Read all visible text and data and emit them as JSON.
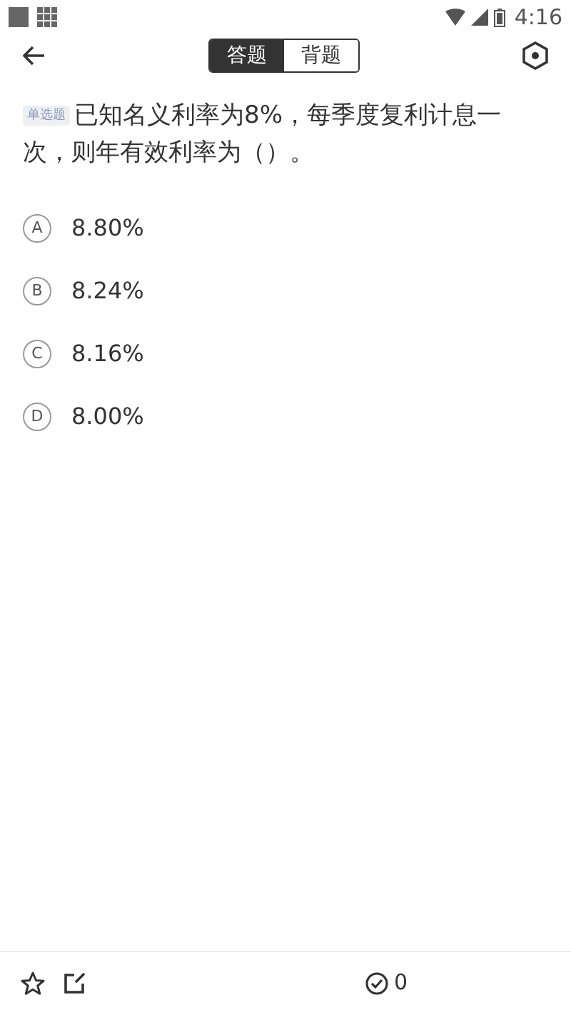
{
  "status_bar": {
    "time": "4:16"
  },
  "header": {
    "tabs": [
      {
        "label": "答题",
        "selected": true
      },
      {
        "label": "背题",
        "selected": false
      }
    ]
  },
  "question": {
    "type_tag": "单选题",
    "text": "已知名义利率为8%，每季度复利计息一次，则年有效利率为（）。"
  },
  "options": [
    {
      "letter": "A",
      "text": "8.80%",
      "selected": false
    },
    {
      "letter": "B",
      "text": "8.24%",
      "selected": false
    },
    {
      "letter": "C",
      "text": "8.16%",
      "selected": false
    },
    {
      "letter": "D",
      "text": "8.00%",
      "selected": false
    }
  ],
  "bottom_bar": {
    "correct_count": "0"
  }
}
